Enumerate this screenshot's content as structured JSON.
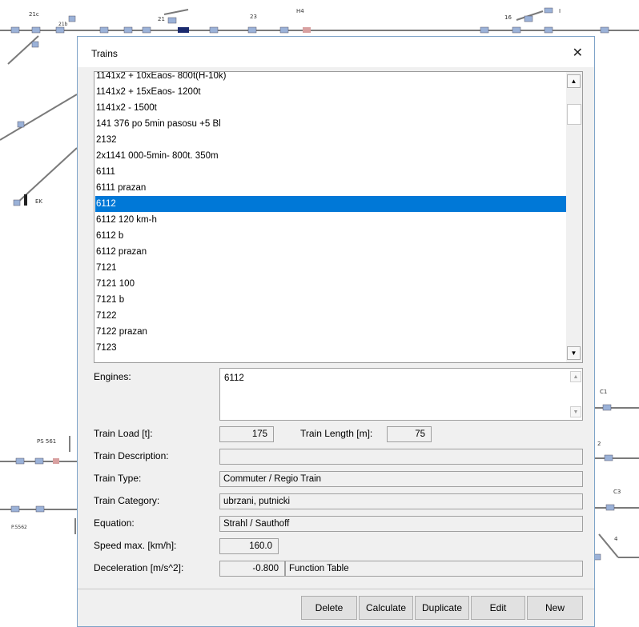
{
  "background": {
    "labels": [
      "21c",
      "21b",
      "21",
      "23",
      "H4",
      "16",
      "I",
      "EK",
      "PS 561",
      "P.5562",
      "C1",
      "C3",
      "4",
      "2"
    ]
  },
  "dialog": {
    "title": "Trains",
    "trains": [
      "1141x2 + 10xEaos- 800t(H-10k)",
      "1141x2 + 15xEaos- 1200t",
      "1141x2 - 1500t",
      "141 376 po 5min pasosu +5 Bl",
      "2132",
      "2x1141 000-5min- 800t. 350m",
      "6111",
      "6111 prazan",
      "6112",
      "6112 120 km-h",
      "6112 b",
      "6112 prazan",
      "7121",
      "7121 100",
      "7121 b",
      "7122",
      "7122 prazan",
      "7123"
    ],
    "selected_train": "6112",
    "labels": {
      "engines": "Engines:",
      "train_load": "Train Load [t]:",
      "train_length": "Train Length [m]:",
      "train_description": "Train Description:",
      "train_type": "Train Type:",
      "train_category": "Train Category:",
      "equation": "Equation:",
      "speed_max": "Speed max. [km/h]:",
      "deceleration": "Deceleration [m/s^2]:"
    },
    "values": {
      "engines": "6112",
      "train_load": "175",
      "train_length": "75",
      "train_description": "",
      "train_type": "Commuter / Regio Train",
      "train_category": "ubrzani, putnicki",
      "equation": "Strahl / Sauthoff",
      "speed_max": "160.0",
      "deceleration": "-0.800",
      "deceleration_mode": "Function Table"
    },
    "buttons": {
      "delete": "Delete",
      "calculate": "Calculate",
      "duplicate": "Duplicate",
      "edit": "Edit",
      "new": "New"
    }
  },
  "colors": {
    "selection": "#0078d7",
    "track": "#7a7a7a",
    "block_blue": "#9bb2d8"
  }
}
